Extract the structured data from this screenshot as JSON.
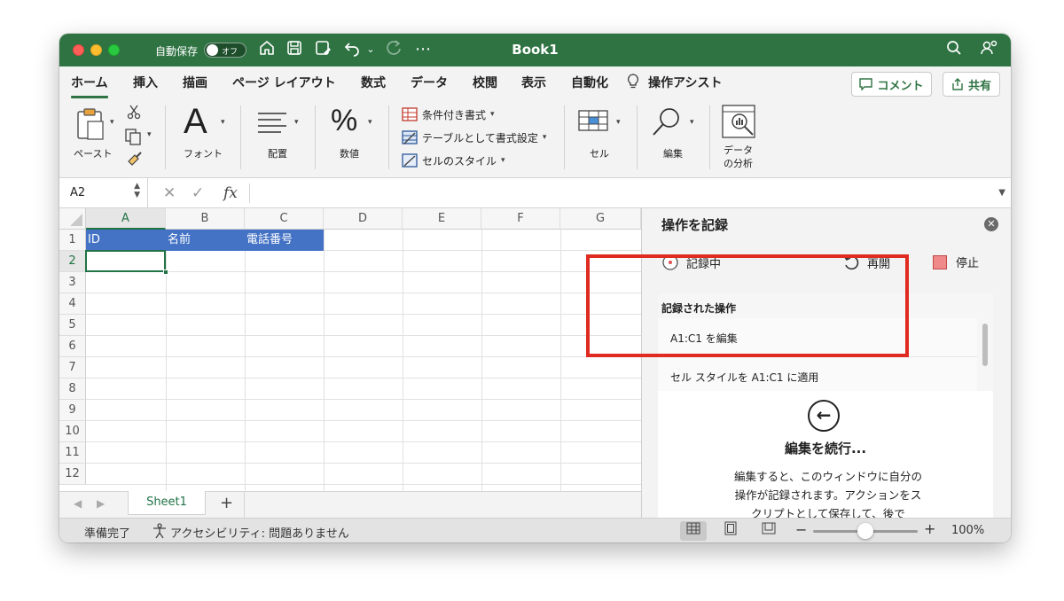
{
  "titlebar": {
    "autosave_label": "自動保存",
    "autosave_state": "オフ",
    "more_label": "⋯",
    "doc_title": "Book1"
  },
  "tabs": [
    {
      "label": "ホーム"
    },
    {
      "label": "挿入"
    },
    {
      "label": "描画"
    },
    {
      "label": "ページ レイアウト"
    },
    {
      "label": "数式"
    },
    {
      "label": "データ"
    },
    {
      "label": "校閲"
    },
    {
      "label": "表示"
    },
    {
      "label": "自動化"
    },
    {
      "label": "操作アシスト"
    }
  ],
  "actions": {
    "comment": "コメント",
    "share": "共有"
  },
  "ribbon": {
    "paste": "ペースト",
    "font": "フォント",
    "align": "配置",
    "number": "数値",
    "styles": [
      "条件付き書式",
      "テーブルとして書式設定",
      "セルのスタイル"
    ],
    "cells": "セル",
    "edit": "編集",
    "analyze_line1": "データ",
    "analyze_line2": "の分析"
  },
  "formula_bar": {
    "name_box": "A2",
    "fx": "fx",
    "content": ""
  },
  "grid": {
    "columns": [
      "A",
      "B",
      "C",
      "D",
      "E",
      "F",
      "G"
    ],
    "rows": [
      "1",
      "2",
      "3",
      "4",
      "5",
      "6",
      "7",
      "8",
      "9",
      "10",
      "11",
      "12"
    ],
    "header_cells": [
      "ID",
      "名前",
      "電話番号"
    ],
    "header_fill": "#4472c4",
    "selected_cell": "A2"
  },
  "sheet_tabs": {
    "active": "Sheet1",
    "add": "+"
  },
  "pane": {
    "title": "操作を記録",
    "recording": "記録中",
    "replay": "再開",
    "stop": "停止",
    "recorded_heading": "記録された操作",
    "recorded_items": [
      "A1:C1 を編集",
      "セル スタイルを A1:C1 に適用"
    ],
    "continue_title": "編集を続行...",
    "continue_body": "編集すると、このウィンドウに自分の操作が記録されます。アクションをスクリプトとして保存して、後で"
  },
  "status": {
    "ready": "準備完了",
    "accessibility": "アクセシビリティ: 問題ありません",
    "zoom": "100%"
  },
  "colors": {
    "brand": "#2f7343",
    "highlight": "#e02b20"
  }
}
